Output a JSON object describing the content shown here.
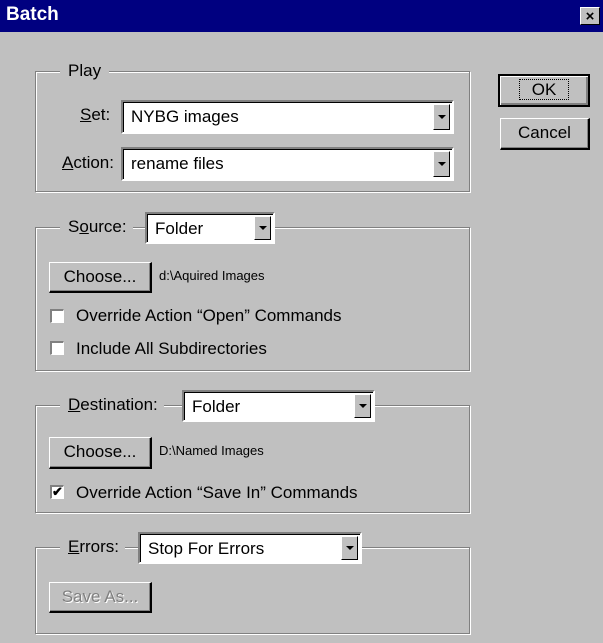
{
  "window": {
    "title": "Batch",
    "close_label": "×"
  },
  "buttons": {
    "ok": "OK",
    "cancel": "Cancel"
  },
  "play": {
    "legend": "Play",
    "set_label": {
      "key": "S",
      "rest": "et:"
    },
    "set_value": "NYBG images",
    "action_label": {
      "key": "A",
      "rest": "ction:"
    },
    "action_value": "rename files"
  },
  "source": {
    "legend": {
      "pre": "S",
      "key": "o",
      "rest": "urce:"
    },
    "value": "Folder",
    "choose_label": "Choose...",
    "path": "d:\\Aquired Images",
    "override_open": {
      "label": "Override Action “Open” Commands",
      "checked": false
    },
    "include_subdirs": {
      "label": "Include All Subdirectories",
      "checked": false
    }
  },
  "destination": {
    "legend": {
      "key": "D",
      "rest": "estination:"
    },
    "value": "Folder",
    "choose_label": "Choose...",
    "path": "D:\\Named Images",
    "override_save": {
      "label": "Override Action “Save In” Commands",
      "checked": true,
      "mark": "✔"
    }
  },
  "errors": {
    "legend": {
      "key": "E",
      "rest": "rrors:"
    },
    "value": "Stop For Errors",
    "save_as_label": "Save As..."
  }
}
